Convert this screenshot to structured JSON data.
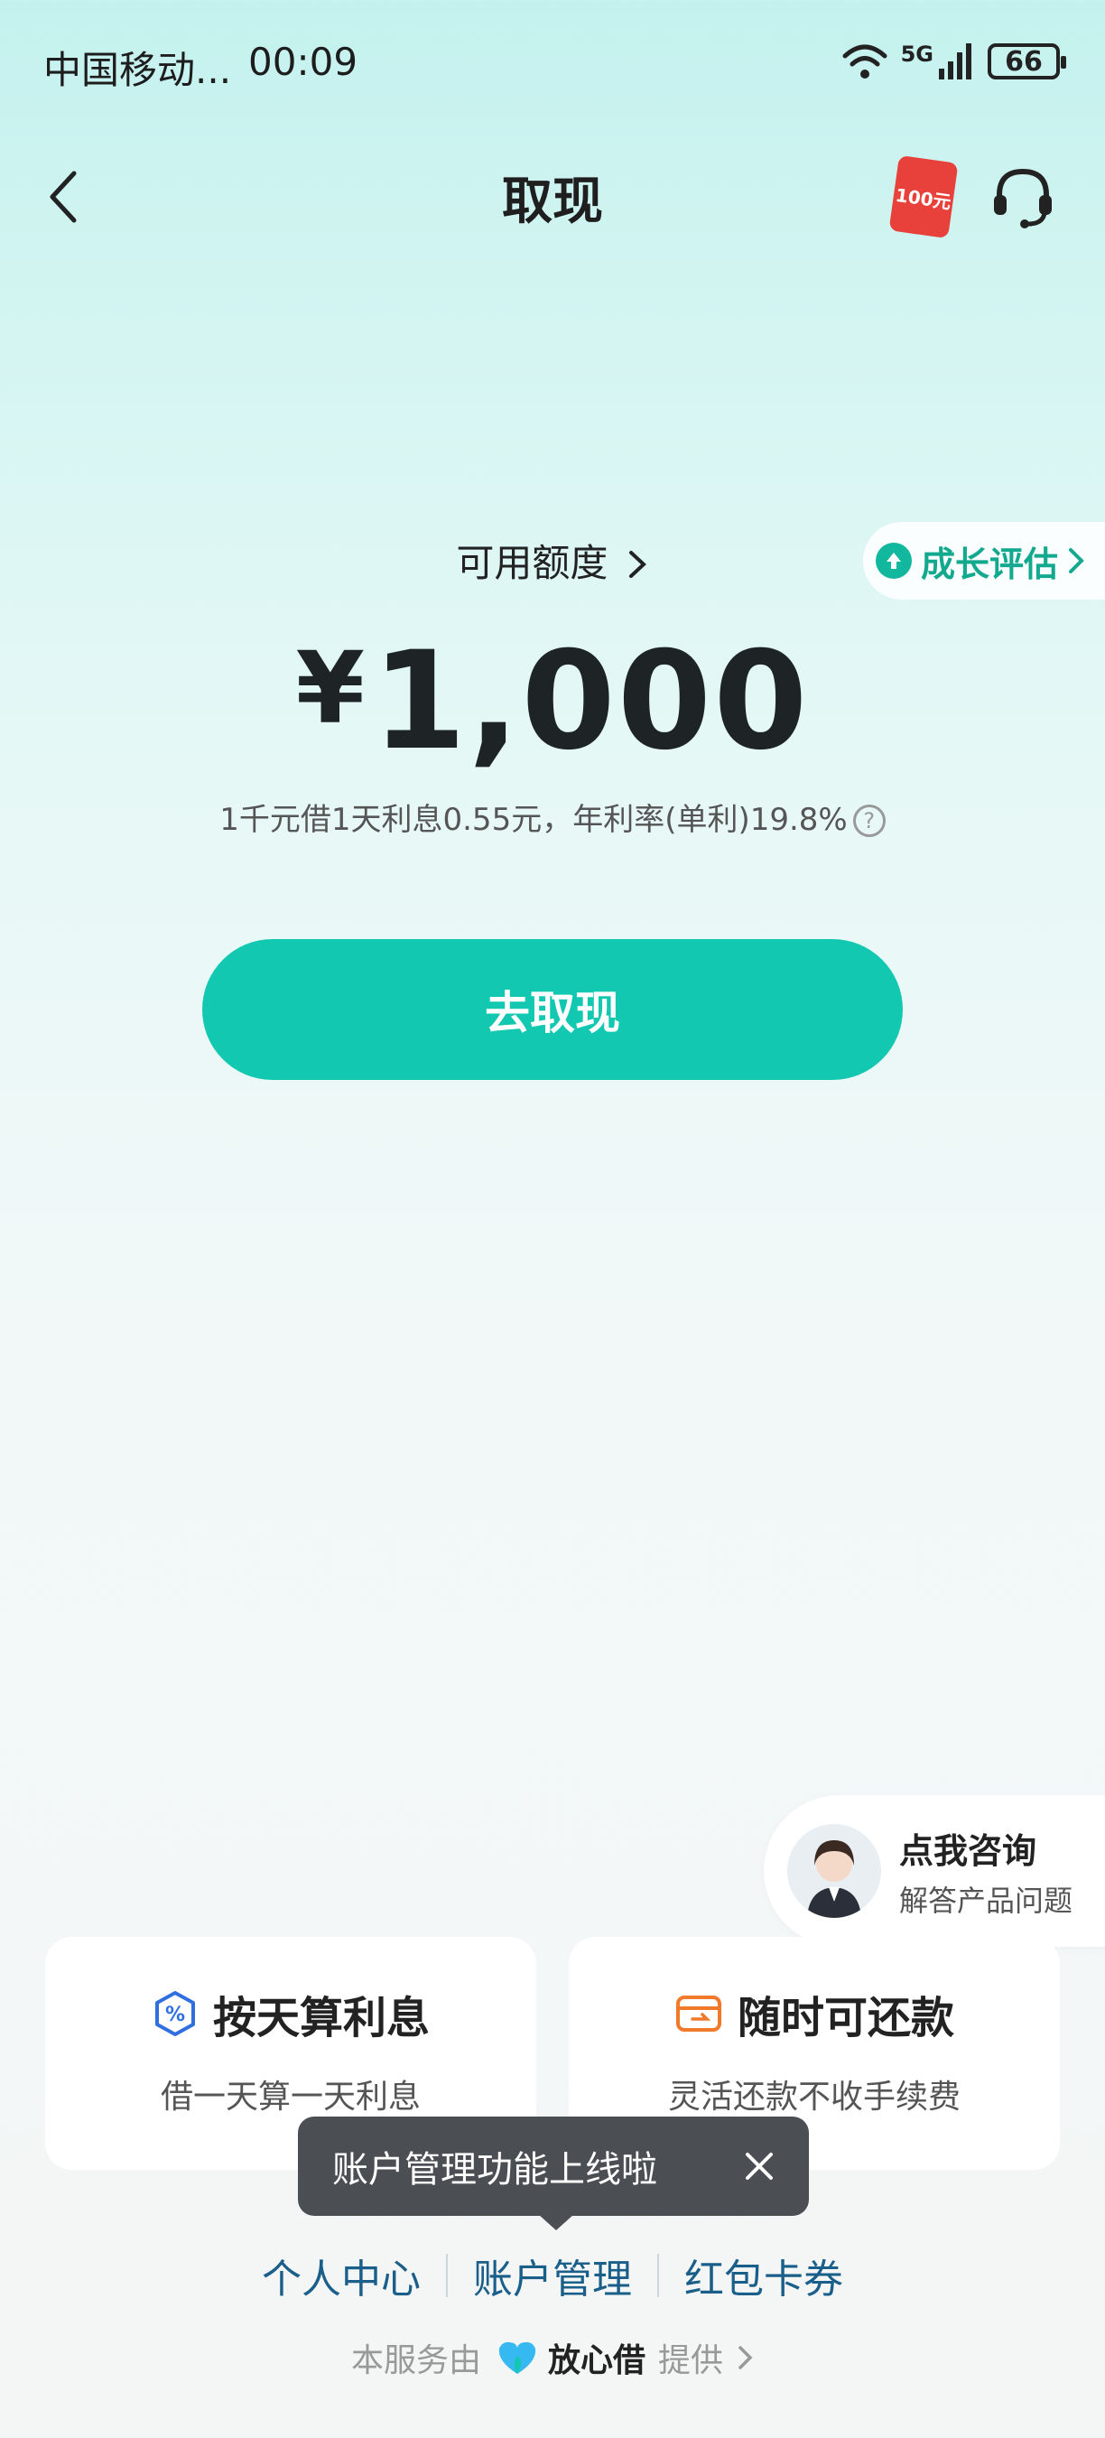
{
  "status_bar": {
    "carrier": "中国移动...",
    "time": "00:09",
    "network": "5G",
    "battery": "66"
  },
  "nav": {
    "title": "取现",
    "redpacket_label": "100元"
  },
  "credit": {
    "label": "可用额度",
    "currency": "¥",
    "amount": "1,000",
    "rate_text": "1千元借1天利息0.55元，年利率(单利)19.8%",
    "growth_label": "成长评估"
  },
  "withdraw_button": "去取现",
  "consult": {
    "title": "点我咨询",
    "subtitle": "解答产品问题"
  },
  "features": [
    {
      "title": "按天算利息",
      "subtitle": "借一天算一天利息"
    },
    {
      "title": "随时可还款",
      "subtitle": "灵活还款不收手续费"
    }
  ],
  "toast": {
    "text": "账户管理功能上线啦"
  },
  "bottom_links": [
    "个人中心",
    "账户管理",
    "红包卡券"
  ],
  "provider": {
    "prefix": "本服务由",
    "brand": "放心借",
    "suffix": "提供"
  },
  "colors": {
    "accent": "#12c8b0",
    "link": "#1a5e8a",
    "growth": "#13a98f"
  }
}
